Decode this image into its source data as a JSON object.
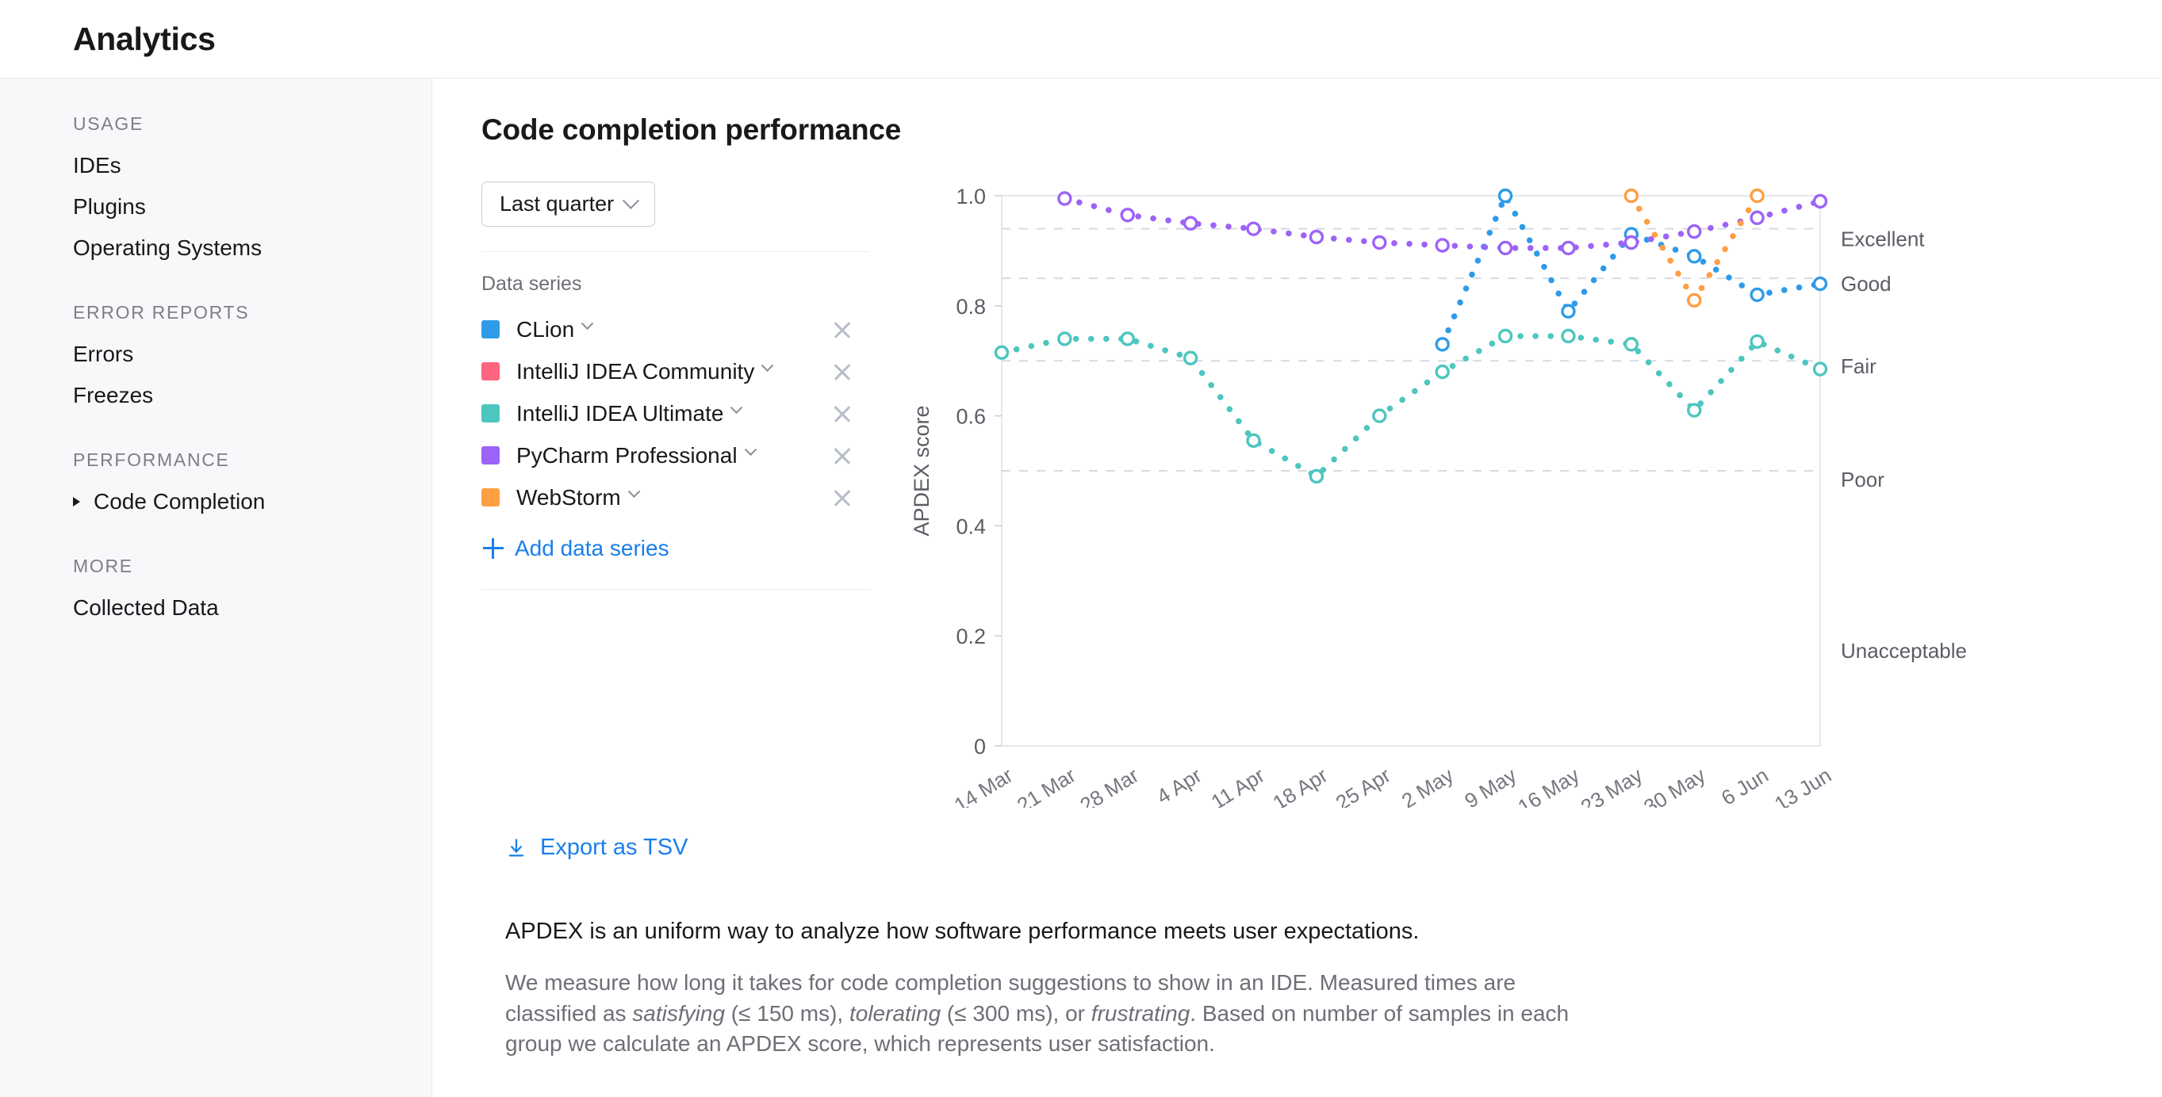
{
  "header": {
    "app_title": "Analytics"
  },
  "sidebar": {
    "sections": [
      {
        "title": "USAGE",
        "items": [
          {
            "label": "IDEs",
            "expandable": false
          },
          {
            "label": "Plugins",
            "expandable": false
          },
          {
            "label": "Operating Systems",
            "expandable": false
          }
        ]
      },
      {
        "title": "ERROR REPORTS",
        "items": [
          {
            "label": "Errors",
            "expandable": false
          },
          {
            "label": "Freezes",
            "expandable": false
          }
        ]
      },
      {
        "title": "PERFORMANCE",
        "items": [
          {
            "label": "Code Completion",
            "expandable": true
          }
        ]
      },
      {
        "title": "MORE",
        "items": [
          {
            "label": "Collected Data",
            "expandable": false
          }
        ]
      }
    ]
  },
  "main": {
    "page_title": "Code completion performance",
    "period_select": {
      "value": "Last quarter",
      "icon": "chevron-down-icon"
    },
    "series_header": "Data series",
    "series": [
      {
        "label": "CLion",
        "color": "#2F9BE8",
        "remove_icon": "close-icon"
      },
      {
        "label": "IntelliJ IDEA Community",
        "color": "#FF6480",
        "remove_icon": "close-icon"
      },
      {
        "label": "IntelliJ IDEA Ultimate",
        "color": "#4CC6BE",
        "remove_icon": "close-icon"
      },
      {
        "label": "PyCharm Professional",
        "color": "#9D63F7",
        "remove_icon": "close-icon"
      },
      {
        "label": "WebStorm",
        "color": "#FF9E42",
        "remove_icon": "close-icon"
      }
    ],
    "add_series_label": "Add data series",
    "add_series_icon": "plus-icon",
    "export_label": "Export as TSV",
    "export_icon": "download-icon",
    "prose_lead": "APDEX is an uniform way to analyze how software performance meets user expectations.",
    "prose_body_parts": {
      "p1": "We measure how long it takes for code completion suggestions to show in an IDE. Measured times are classified as ",
      "em1": "satisfying",
      "p2": " (≤ 150 ms), ",
      "em2": "tolerating",
      "p3": " (≤ 300 ms), or ",
      "em3": "frustrating",
      "p4": ". Based on number of samples in each group we calculate an APDEX score, which represents user satisfaction."
    }
  },
  "chart_data": {
    "type": "line",
    "title": "Code completion performance",
    "xlabel": "",
    "ylabel": "APDEX score",
    "ylim": [
      0,
      1.0
    ],
    "ytick_labels": [
      "0",
      "0.2",
      "0.4",
      "0.6",
      "0.8",
      "1.0"
    ],
    "ytick_values": [
      0,
      0.2,
      0.4,
      0.6,
      0.8,
      1.0
    ],
    "grid": true,
    "grid_style": "dashed-horizontal",
    "legend_position": "left-panel",
    "line_style": "dotted",
    "categories": [
      "14 Mar",
      "21 Mar",
      "28 Mar",
      "4 Apr",
      "11 Apr",
      "18 Apr",
      "25 Apr",
      "2 May",
      "9 May",
      "16 May",
      "23 May",
      "30 May",
      "6 Jun",
      "13 Jun"
    ],
    "threshold_bands": [
      {
        "label": "Excellent",
        "value": 0.94
      },
      {
        "label": "Good",
        "value": 0.85
      },
      {
        "label": "Fair",
        "value": 0.7
      },
      {
        "label": "Poor",
        "value": 0.5
      },
      {
        "label": "Unacceptable",
        "value": 0.0
      }
    ],
    "series": [
      {
        "name": "CLion",
        "color": "#2F9BE8",
        "x": [
          "2 May",
          "9 May",
          "16 May",
          "23 May",
          "30 May",
          "6 Jun",
          "13 Jun"
        ],
        "values": [
          0.73,
          1.0,
          0.79,
          0.93,
          0.89,
          0.82,
          0.84
        ]
      },
      {
        "name": "IntelliJ IDEA Community",
        "color": "#FF6480",
        "x": [],
        "values": []
      },
      {
        "name": "IntelliJ IDEA Ultimate",
        "color": "#4CC6BE",
        "x": [
          "14 Mar",
          "21 Mar",
          "28 Mar",
          "4 Apr",
          "11 Apr",
          "18 Apr",
          "25 Apr",
          "2 May",
          "9 May",
          "16 May",
          "23 May",
          "30 May",
          "6 Jun",
          "13 Jun"
        ],
        "values": [
          0.715,
          0.74,
          0.74,
          0.705,
          0.555,
          0.49,
          0.6,
          0.68,
          0.745,
          0.745,
          0.73,
          0.61,
          0.735,
          0.685
        ]
      },
      {
        "name": "PyCharm Professional",
        "color": "#9D63F7",
        "x": [
          "21 Mar",
          "28 Mar",
          "4 Apr",
          "11 Apr",
          "18 Apr",
          "25 Apr",
          "2 May",
          "9 May",
          "16 May",
          "23 May",
          "30 May",
          "6 Jun",
          "13 Jun"
        ],
        "values": [
          0.995,
          0.965,
          0.95,
          0.94,
          0.925,
          0.915,
          0.91,
          0.905,
          0.905,
          0.915,
          0.935,
          0.96,
          0.99
        ]
      },
      {
        "name": "WebStorm",
        "color": "#FF9E42",
        "x": [
          "23 May",
          "30 May",
          "6 Jun"
        ],
        "values": [
          1.0,
          0.81,
          1.0
        ]
      }
    ]
  }
}
